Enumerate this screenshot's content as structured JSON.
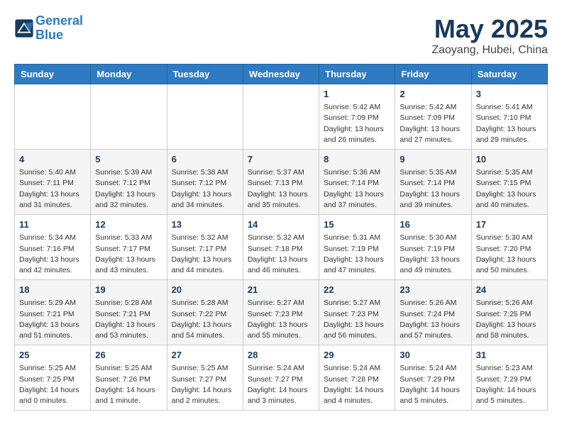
{
  "header": {
    "logo_line1": "General",
    "logo_line2": "Blue",
    "month": "May 2025",
    "location": "Zaoyang, Hubei, China"
  },
  "weekdays": [
    "Sunday",
    "Monday",
    "Tuesday",
    "Wednesday",
    "Thursday",
    "Friday",
    "Saturday"
  ],
  "weeks": [
    [
      {
        "day": "",
        "info": ""
      },
      {
        "day": "",
        "info": ""
      },
      {
        "day": "",
        "info": ""
      },
      {
        "day": "",
        "info": ""
      },
      {
        "day": "1",
        "info": "Sunrise: 5:42 AM\nSunset: 7:09 PM\nDaylight: 13 hours and 26 minutes."
      },
      {
        "day": "2",
        "info": "Sunrise: 5:42 AM\nSunset: 7:09 PM\nDaylight: 13 hours and 27 minutes."
      },
      {
        "day": "3",
        "info": "Sunrise: 5:41 AM\nSunset: 7:10 PM\nDaylight: 13 hours and 29 minutes."
      }
    ],
    [
      {
        "day": "4",
        "info": "Sunrise: 5:40 AM\nSunset: 7:11 PM\nDaylight: 13 hours and 31 minutes."
      },
      {
        "day": "5",
        "info": "Sunrise: 5:39 AM\nSunset: 7:12 PM\nDaylight: 13 hours and 32 minutes."
      },
      {
        "day": "6",
        "info": "Sunrise: 5:38 AM\nSunset: 7:12 PM\nDaylight: 13 hours and 34 minutes."
      },
      {
        "day": "7",
        "info": "Sunrise: 5:37 AM\nSunset: 7:13 PM\nDaylight: 13 hours and 35 minutes."
      },
      {
        "day": "8",
        "info": "Sunrise: 5:36 AM\nSunset: 7:14 PM\nDaylight: 13 hours and 37 minutes."
      },
      {
        "day": "9",
        "info": "Sunrise: 5:35 AM\nSunset: 7:14 PM\nDaylight: 13 hours and 39 minutes."
      },
      {
        "day": "10",
        "info": "Sunrise: 5:35 AM\nSunset: 7:15 PM\nDaylight: 13 hours and 40 minutes."
      }
    ],
    [
      {
        "day": "11",
        "info": "Sunrise: 5:34 AM\nSunset: 7:16 PM\nDaylight: 13 hours and 42 minutes."
      },
      {
        "day": "12",
        "info": "Sunrise: 5:33 AM\nSunset: 7:17 PM\nDaylight: 13 hours and 43 minutes."
      },
      {
        "day": "13",
        "info": "Sunrise: 5:32 AM\nSunset: 7:17 PM\nDaylight: 13 hours and 44 minutes."
      },
      {
        "day": "14",
        "info": "Sunrise: 5:32 AM\nSunset: 7:18 PM\nDaylight: 13 hours and 46 minutes."
      },
      {
        "day": "15",
        "info": "Sunrise: 5:31 AM\nSunset: 7:19 PM\nDaylight: 13 hours and 47 minutes."
      },
      {
        "day": "16",
        "info": "Sunrise: 5:30 AM\nSunset: 7:19 PM\nDaylight: 13 hours and 49 minutes."
      },
      {
        "day": "17",
        "info": "Sunrise: 5:30 AM\nSunset: 7:20 PM\nDaylight: 13 hours and 50 minutes."
      }
    ],
    [
      {
        "day": "18",
        "info": "Sunrise: 5:29 AM\nSunset: 7:21 PM\nDaylight: 13 hours and 51 minutes."
      },
      {
        "day": "19",
        "info": "Sunrise: 5:28 AM\nSunset: 7:21 PM\nDaylight: 13 hours and 53 minutes."
      },
      {
        "day": "20",
        "info": "Sunrise: 5:28 AM\nSunset: 7:22 PM\nDaylight: 13 hours and 54 minutes."
      },
      {
        "day": "21",
        "info": "Sunrise: 5:27 AM\nSunset: 7:23 PM\nDaylight: 13 hours and 55 minutes."
      },
      {
        "day": "22",
        "info": "Sunrise: 5:27 AM\nSunset: 7:23 PM\nDaylight: 13 hours and 56 minutes."
      },
      {
        "day": "23",
        "info": "Sunrise: 5:26 AM\nSunset: 7:24 PM\nDaylight: 13 hours and 57 minutes."
      },
      {
        "day": "24",
        "info": "Sunrise: 5:26 AM\nSunset: 7:25 PM\nDaylight: 13 hours and 58 minutes."
      }
    ],
    [
      {
        "day": "25",
        "info": "Sunrise: 5:25 AM\nSunset: 7:25 PM\nDaylight: 14 hours and 0 minutes."
      },
      {
        "day": "26",
        "info": "Sunrise: 5:25 AM\nSunset: 7:26 PM\nDaylight: 14 hours and 1 minute."
      },
      {
        "day": "27",
        "info": "Sunrise: 5:25 AM\nSunset: 7:27 PM\nDaylight: 14 hours and 2 minutes."
      },
      {
        "day": "28",
        "info": "Sunrise: 5:24 AM\nSunset: 7:27 PM\nDaylight: 14 hours and 3 minutes."
      },
      {
        "day": "29",
        "info": "Sunrise: 5:24 AM\nSunset: 7:28 PM\nDaylight: 14 hours and 4 minutes."
      },
      {
        "day": "30",
        "info": "Sunrise: 5:24 AM\nSunset: 7:29 PM\nDaylight: 14 hours and 5 minutes."
      },
      {
        "day": "31",
        "info": "Sunrise: 5:23 AM\nSunset: 7:29 PM\nDaylight: 14 hours and 5 minutes."
      }
    ]
  ]
}
